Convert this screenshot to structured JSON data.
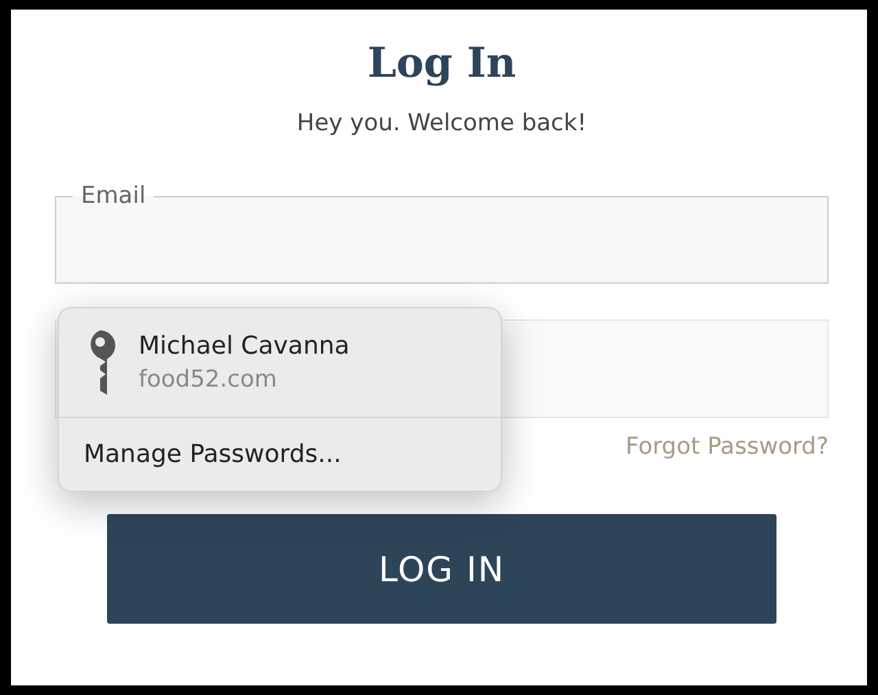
{
  "title": "Log In",
  "subtitle": "Hey you. Welcome back!",
  "email_field": {
    "label": "Email"
  },
  "forgot_link": "Forgot Password?",
  "login_button": "LOG IN",
  "autofill_popup": {
    "account": {
      "name": "Michael Cavanna",
      "site": "food52.com"
    },
    "manage": "Manage Passwords..."
  }
}
